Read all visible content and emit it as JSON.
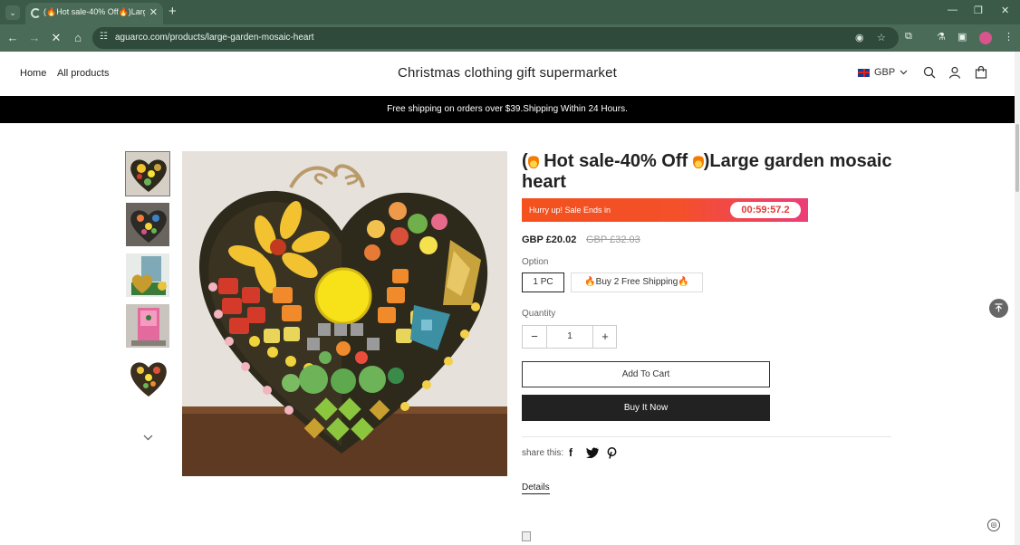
{
  "browser": {
    "tab": {
      "title": "(🔥Hot sale-40% Off🔥)Large garden mosaic heart"
    },
    "url": "aguarco.com/products/large-garden-mosaic-heart"
  },
  "header": {
    "nav": [
      "Home",
      "All products"
    ],
    "store_title": "Christmas clothing gift supermarket",
    "currency": "GBP"
  },
  "announcement": "Free shipping on orders over $39.Shipping Within 24 Hours.",
  "product": {
    "title_prefix": "(",
    "title_main": "Hot sale-40% Off",
    "title_suffix": ")Large garden mosaic heart",
    "sale_text": "Hurry up! Sale Ends in",
    "timer": "00:59:57.2",
    "price": "GBP £20.02",
    "compare_price": "GBP £32.03",
    "option_label": "Option",
    "options": [
      "1 PC",
      "🔥Buy 2 Free Shipping🔥"
    ],
    "selected_option": "1 PC",
    "quantity_label": "Quantity",
    "quantity": "1",
    "add_to_cart": "Add To Cart",
    "buy_now": "Buy It Now",
    "share_label": "share this:",
    "details": "Details"
  }
}
